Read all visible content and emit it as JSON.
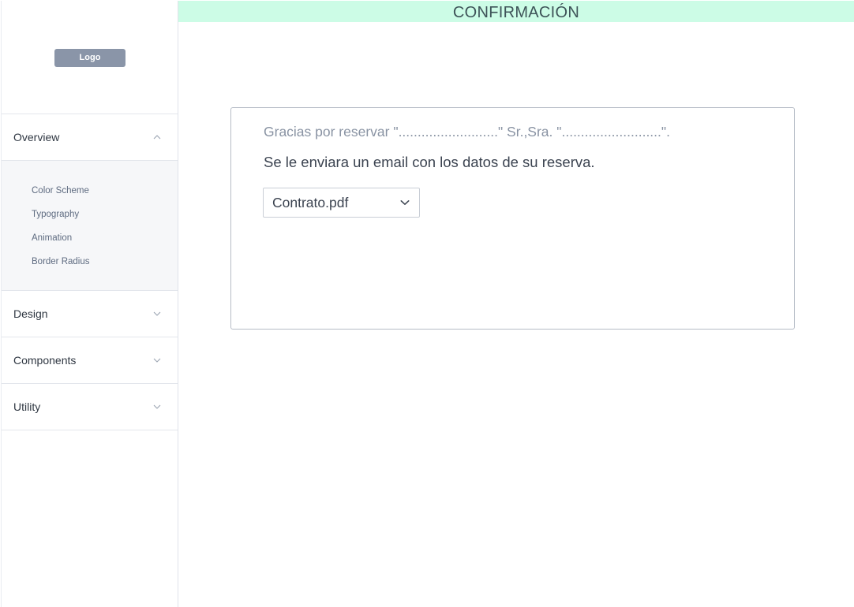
{
  "sidebar": {
    "logo_label": "Logo",
    "sections": [
      {
        "label": "Overview",
        "expanded": true,
        "icon": "chevron-up-icon"
      },
      {
        "label": "Design",
        "expanded": false,
        "icon": "chevron-down-icon"
      },
      {
        "label": "Components",
        "expanded": false,
        "icon": "chevron-down-icon"
      },
      {
        "label": "Utility",
        "expanded": false,
        "icon": "chevron-down-icon"
      }
    ],
    "overview_items": [
      {
        "label": "Color Scheme"
      },
      {
        "label": "Typography"
      },
      {
        "label": "Animation"
      },
      {
        "label": "Border Radius"
      }
    ]
  },
  "header": {
    "title": "CONFIRMACIÓN",
    "background": "#ccfce6"
  },
  "confirmation": {
    "thanks_text": "Gracias por reservar \"..........................\" Sr.,Sra. \"..........................\".",
    "email_text": "Se le enviara un email con los datos de su reserva.",
    "document_select": {
      "selected": "Contrato.pdf",
      "icon": "chevron-down-icon"
    }
  }
}
